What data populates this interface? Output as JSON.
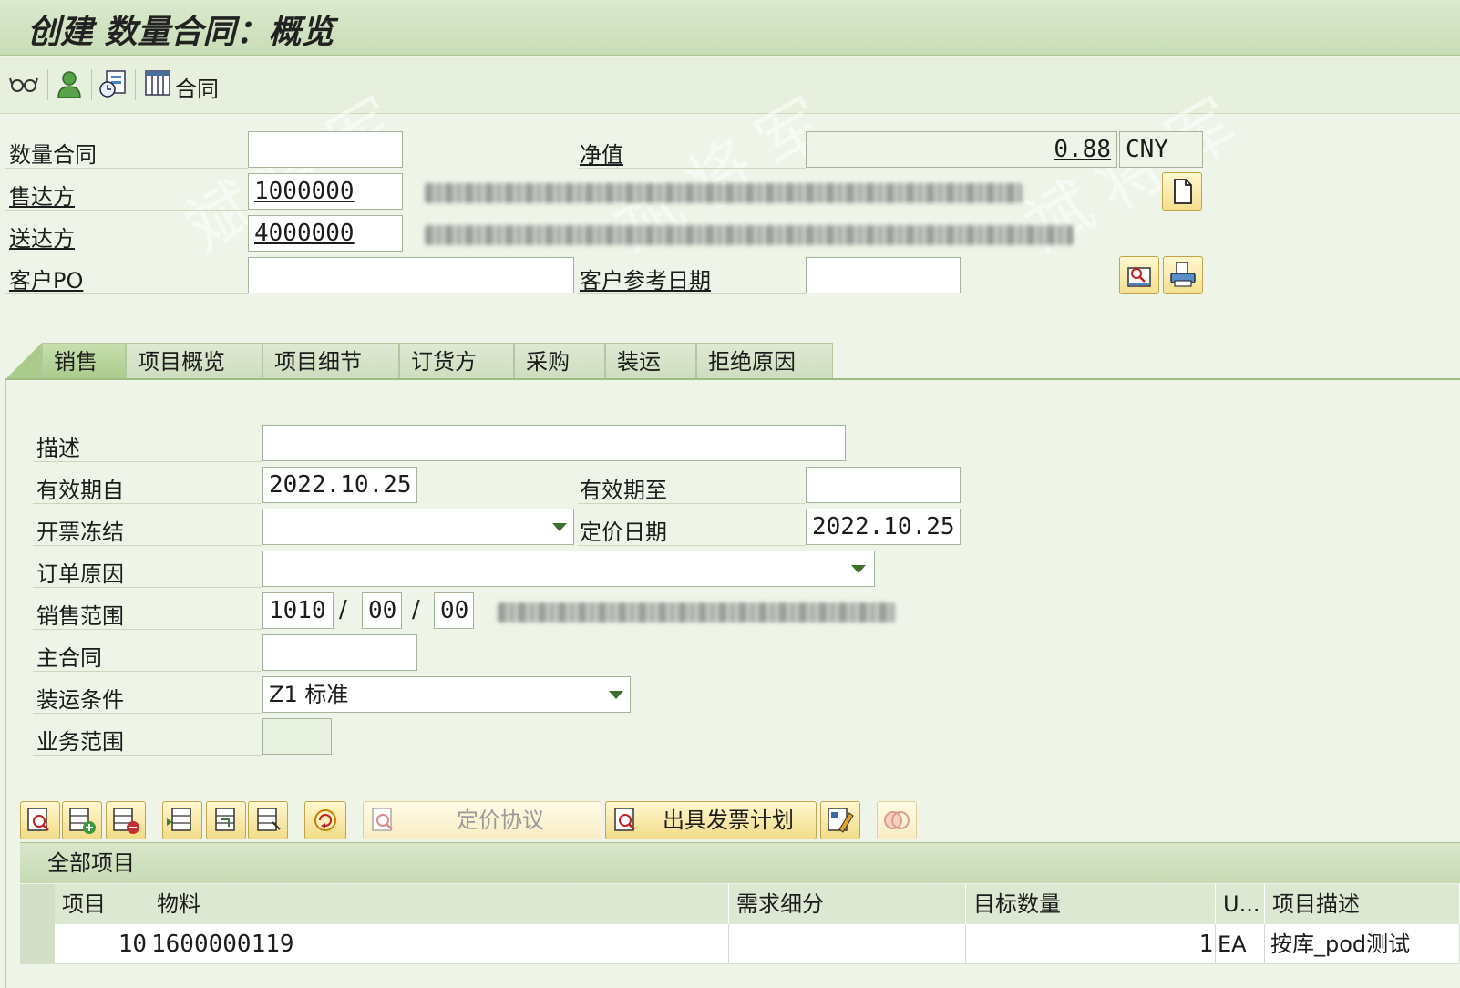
{
  "title": "创建 数量合同：概览",
  "toolbar": {
    "contract_label": "合同"
  },
  "header": {
    "contract_label": "数量合同",
    "contract_value": "",
    "soldto_label": "售达方",
    "soldto_value": "1000000",
    "shipto_label": "送达方",
    "shipto_value": "4000000",
    "po_label": "客户PO",
    "po_value": "",
    "netvalue_label": "净值",
    "netvalue_value": "0.88",
    "currency": "CNY",
    "refdate_label": "客户参考日期",
    "refdate_value": ""
  },
  "tabs": [
    {
      "label": "销售",
      "active": true
    },
    {
      "label": "项目概览"
    },
    {
      "label": "项目细节"
    },
    {
      "label": "订货方"
    },
    {
      "label": "采购"
    },
    {
      "label": "装运"
    },
    {
      "label": "拒绝原因"
    }
  ],
  "sales": {
    "desc_label": "描述",
    "desc_value": "",
    "validfrom_label": "有效期自",
    "validfrom_value": "2022.10.25",
    "validto_label": "有效期至",
    "validto_value": "",
    "billblock_label": "开票冻结",
    "billblock_value": "",
    "pricedate_label": "定价日期",
    "pricedate_value": "2022.10.25",
    "orderreason_label": "订单原因",
    "orderreason_value": "",
    "salesarea_label": "销售范围",
    "salesorg": "1010",
    "distchannel": "00",
    "division": "00",
    "salesarea_sep": "/",
    "mastercontract_label": "主合同",
    "mastercontract_value": "",
    "shipcond_label": "装运条件",
    "shipcond_value": "Z1 标准",
    "bizarea_label": "业务范围",
    "bizarea_value": ""
  },
  "itemtoolbar": {
    "pricing_label": "定价协议",
    "billingplan_label": "出具发票计划"
  },
  "items": {
    "title": "全部项目",
    "columns": [
      "项目",
      "物料",
      "需求细分",
      "目标数量",
      "U...",
      "项目描述"
    ],
    "rows": [
      {
        "item": "10",
        "material": "1600000119",
        "req": "",
        "qty": "1",
        "unit": "EA",
        "desc": "按库_pod测试"
      }
    ]
  },
  "colors": {
    "accent": "#aacb8c",
    "button": "#f4df90",
    "background": "#eef5e8"
  }
}
